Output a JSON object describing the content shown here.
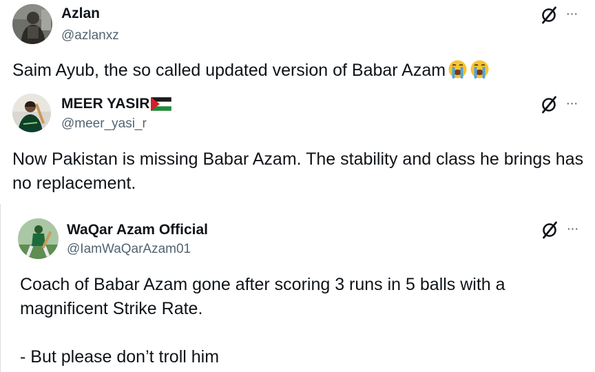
{
  "posts": [
    {
      "author_name": "Azlan",
      "author_handle": "@azlanxz",
      "text": "Saim Ayub, the so called updated version of Babar Azam",
      "emoji": [
        "loudly-crying-face",
        "loudly-crying-face"
      ],
      "more_label": "···"
    },
    {
      "author_name": "MEER YASIR",
      "author_handle": "@meer_yasi_r",
      "name_flag": "palestine-flag",
      "text": "Now Pakistan is missing Babar Azam. The stability and class he brings has no replacement.",
      "more_label": "···"
    },
    {
      "author_name": "WaQar Azam Official",
      "author_handle": "@IamWaQarAzam01",
      "text": "Coach of Babar Azam gone after scoring 3 runs in 5 balls with a magnificent Strike Rate.\n\n- But please don’t troll him",
      "more_label": "···"
    }
  ],
  "colors": {
    "text": "#0f1419",
    "secondary": "#536471",
    "emoji_face": "#f7c430",
    "emoji_tears": "#4ea3e6"
  }
}
